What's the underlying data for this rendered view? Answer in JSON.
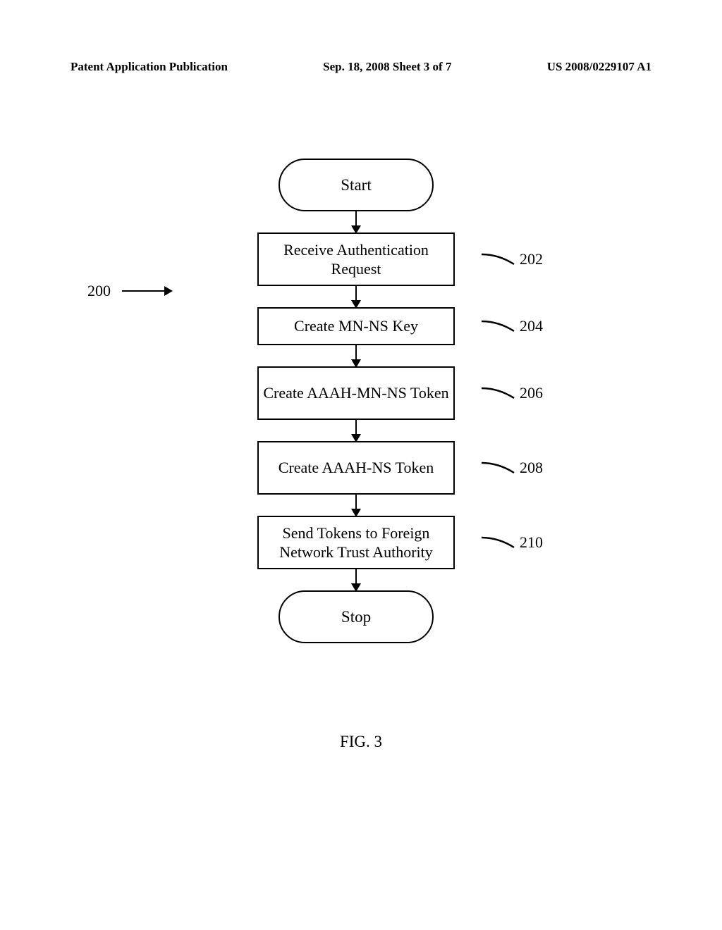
{
  "header": {
    "pub_type": "Patent Application Publication",
    "date_sheet": "Sep. 18, 2008  Sheet 3 of 7",
    "pub_number": "US 2008/0229107 A1"
  },
  "flowchart": {
    "ref": "200",
    "start": "Start",
    "stop": "Stop",
    "steps": [
      {
        "label": "Receive Authentication Request",
        "ref": "202",
        "lines": 2
      },
      {
        "label": "Create MN-NS Key",
        "ref": "204",
        "lines": 1
      },
      {
        "label": "Create AAAH-MN-NS Token",
        "ref": "206",
        "lines": 2
      },
      {
        "label": "Create AAAH-NS Token",
        "ref": "208",
        "lines": 2
      },
      {
        "label": "Send Tokens to Foreign Network Trust Authority",
        "ref": "210",
        "lines": 2
      }
    ]
  },
  "figure_label": "FIG. 3"
}
